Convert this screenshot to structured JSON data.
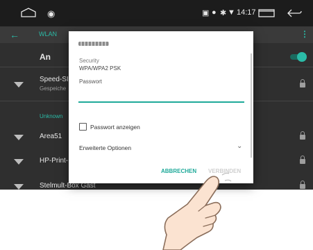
{
  "statusbar": {
    "time": "14:17"
  },
  "appbar": {
    "title": "WLAN"
  },
  "list": {
    "on_label": "An",
    "saved_network": {
      "name": "Speed-SI",
      "status": "Gespeiche"
    },
    "section_header": "Unknown",
    "networks": [
      "Area51",
      "HP-Print-",
      "Stelmult-Box Gast"
    ]
  },
  "dialog": {
    "security_label": "Security",
    "security_value": "WPA/WPA2 PSK",
    "password_label": "Passwort",
    "password_value": "",
    "show_password_label": "Passwort anzeigen",
    "advanced_label": "Erweiterte Optionen",
    "cancel_label": "ABBRECHEN",
    "connect_label": "VERBINDEN"
  },
  "colors": {
    "accent": "#1ea999",
    "dark_bg": "#2f2f2f"
  },
  "icons": [
    "home-icon",
    "assistant-icon",
    "cast-icon",
    "location-icon",
    "bluetooth-icon",
    "wifi-icon",
    "recent-apps-icon",
    "back-icon",
    "lock-icon",
    "chevron-down-icon"
  ]
}
